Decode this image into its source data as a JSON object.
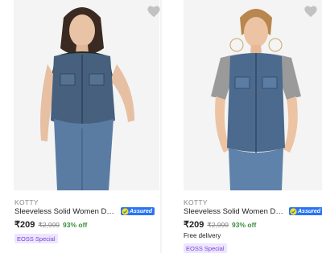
{
  "products": [
    {
      "brand": "KOTTY",
      "title": "Sleeveless Solid Women Denim J...",
      "assured_label": "Assured",
      "price": "₹209",
      "mrp": "₹2,999",
      "discount": "93% off",
      "delivery": "",
      "tag": "EOSS Special"
    },
    {
      "brand": "KOTTY",
      "title": "Sleeveless Solid Women Denim J...",
      "assured_label": "Assured",
      "price": "₹209",
      "mrp": "₹2,999",
      "discount": "93% off",
      "delivery": "Free delivery",
      "tag": "EOSS Special"
    }
  ],
  "icons": {
    "wishlist": "heart-icon",
    "assured": "assured-badge"
  },
  "colors": {
    "price_off": "#388e3c",
    "assured_bg": "#2874f0",
    "tag_text": "#7a3fd6",
    "tag_bg": "#ece6ff",
    "muted": "#878787"
  }
}
